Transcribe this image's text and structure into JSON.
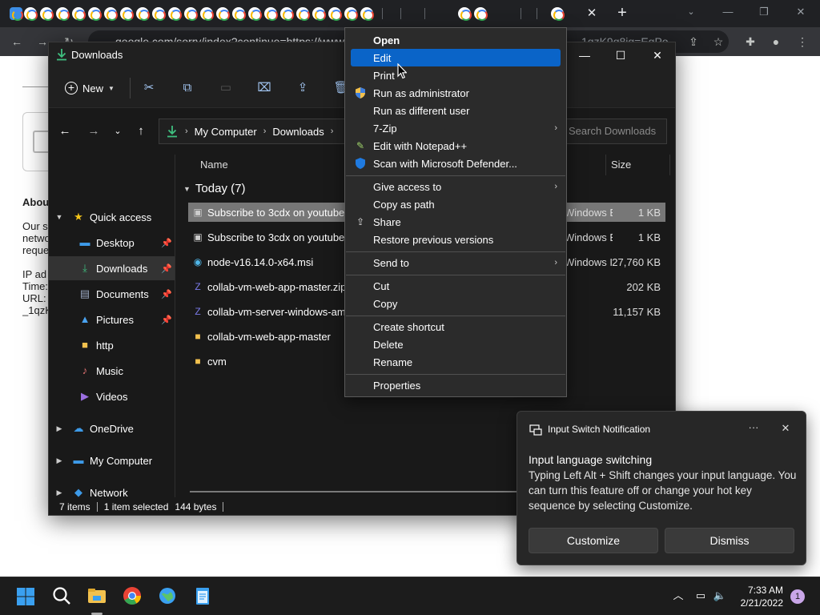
{
  "browser": {
    "omnibox_url": "google.com/sorry/index?continue=https://www",
    "omnibox_tail": "1qzK9g8ig=EgPo"
  },
  "webpage": {
    "about": "About",
    "lines": [
      "Our s",
      "netwo",
      "reque"
    ],
    "ip_lines": [
      "IP ad",
      "Time:",
      "URL: ",
      "_1qzK"
    ]
  },
  "explorer": {
    "title": "Downloads",
    "toolbar": {
      "new_label": "New"
    },
    "address": {
      "crumb1": "My Computer",
      "crumb2": "Downloads"
    },
    "search_placeholder": "Search Downloads",
    "sidebar": {
      "quick_access": "Quick access",
      "items": [
        {
          "label": "Desktop",
          "pinned": true
        },
        {
          "label": "Downloads",
          "pinned": true
        },
        {
          "label": "Documents",
          "pinned": true
        },
        {
          "label": "Pictures",
          "pinned": true
        },
        {
          "label": "http",
          "pinned": false
        },
        {
          "label": "Music",
          "pinned": false
        },
        {
          "label": "Videos",
          "pinned": false
        }
      ],
      "onedrive": "OneDrive",
      "my_computer": "My Computer",
      "network": "Network"
    },
    "columns": {
      "name": "Name",
      "size": "Size"
    },
    "group": "Today (7)",
    "files": [
      {
        "name": "Subscribe to 3cdx on youtube (1).bat",
        "type": "Windows Batch File",
        "size": "1 KB"
      },
      {
        "name": "Subscribe to 3cdx on youtube.bat",
        "type": "Windows Batch File",
        "size": "1 KB"
      },
      {
        "name": "node-v16.14.0-x64.msi",
        "type": "Windows Installer Package",
        "size": "27,760 KB"
      },
      {
        "name": "collab-vm-web-app-master.zip",
        "type": "",
        "size": "202 KB"
      },
      {
        "name": "collab-vm-server-windows-amd64.zip",
        "type": "",
        "size": "11,157 KB"
      },
      {
        "name": "collab-vm-web-app-master",
        "type": "",
        "size": ""
      },
      {
        "name": "cvm",
        "type": "",
        "size": ""
      }
    ],
    "status": {
      "items": "7 items",
      "selected": "1 item selected",
      "size": "144 bytes"
    }
  },
  "context_menu": {
    "items": [
      "Open",
      "Edit",
      "Print",
      "Run as administrator",
      "Run as different user",
      "7-Zip",
      "Edit with Notepad++",
      "Scan with Microsoft Defender...",
      "Give access to",
      "Copy as path",
      "Share",
      "Restore previous versions",
      "Send to",
      "Cut",
      "Copy",
      "Create shortcut",
      "Delete",
      "Rename",
      "Properties"
    ],
    "highlighted": "Edit"
  },
  "toast": {
    "app": "Input Switch Notification",
    "more": "···",
    "title": "Input language switching",
    "body": "Typing Left Alt + Shift changes your input language. You can turn this feature off or change your hot key sequence by selecting Customize.",
    "customize": "Customize",
    "dismiss": "Dismiss"
  },
  "taskbar": {
    "time": "7:33 AM",
    "date": "2/21/2022",
    "notification_count": "1"
  },
  "colors": {
    "accent": "#0a64c8",
    "explorer_bg": "#191919",
    "menu_bg": "#2b2b2b",
    "selection": "#777777"
  }
}
